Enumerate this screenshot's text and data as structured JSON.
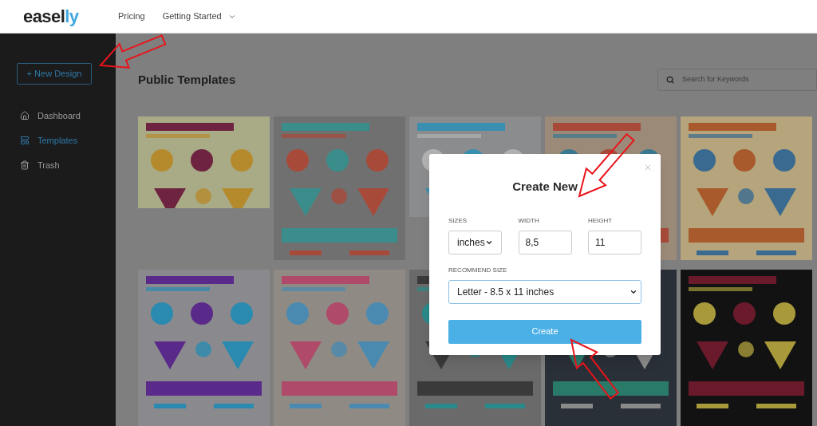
{
  "header": {
    "logo": {
      "text": "easel",
      "accent": "ly"
    },
    "nav": [
      {
        "label": "Pricing",
        "dropdown": false
      },
      {
        "label": "Getting Started",
        "dropdown": true
      }
    ]
  },
  "sidebar": {
    "new_button": "+ New Design",
    "items": [
      {
        "label": "Dashboard",
        "selected": false
      },
      {
        "label": "Templates",
        "selected": true
      },
      {
        "label": "Trash",
        "selected": false
      }
    ]
  },
  "main": {
    "title": "Public Templates",
    "search": {
      "placeholder": "Search for Keywords"
    }
  },
  "dialog": {
    "title": "Create New",
    "fields": [
      {
        "kind": "select",
        "label": "SIZES",
        "value": "inches"
      },
      {
        "kind": "input",
        "label": "WIDTH",
        "value": "8,5"
      },
      {
        "kind": "input",
        "label": "HEIGHT",
        "value": "11"
      }
    ],
    "recommend": {
      "label": "RECOMMEND SIZE",
      "value": "Letter - 8.5 x 11 inches"
    },
    "button": "Create"
  }
}
